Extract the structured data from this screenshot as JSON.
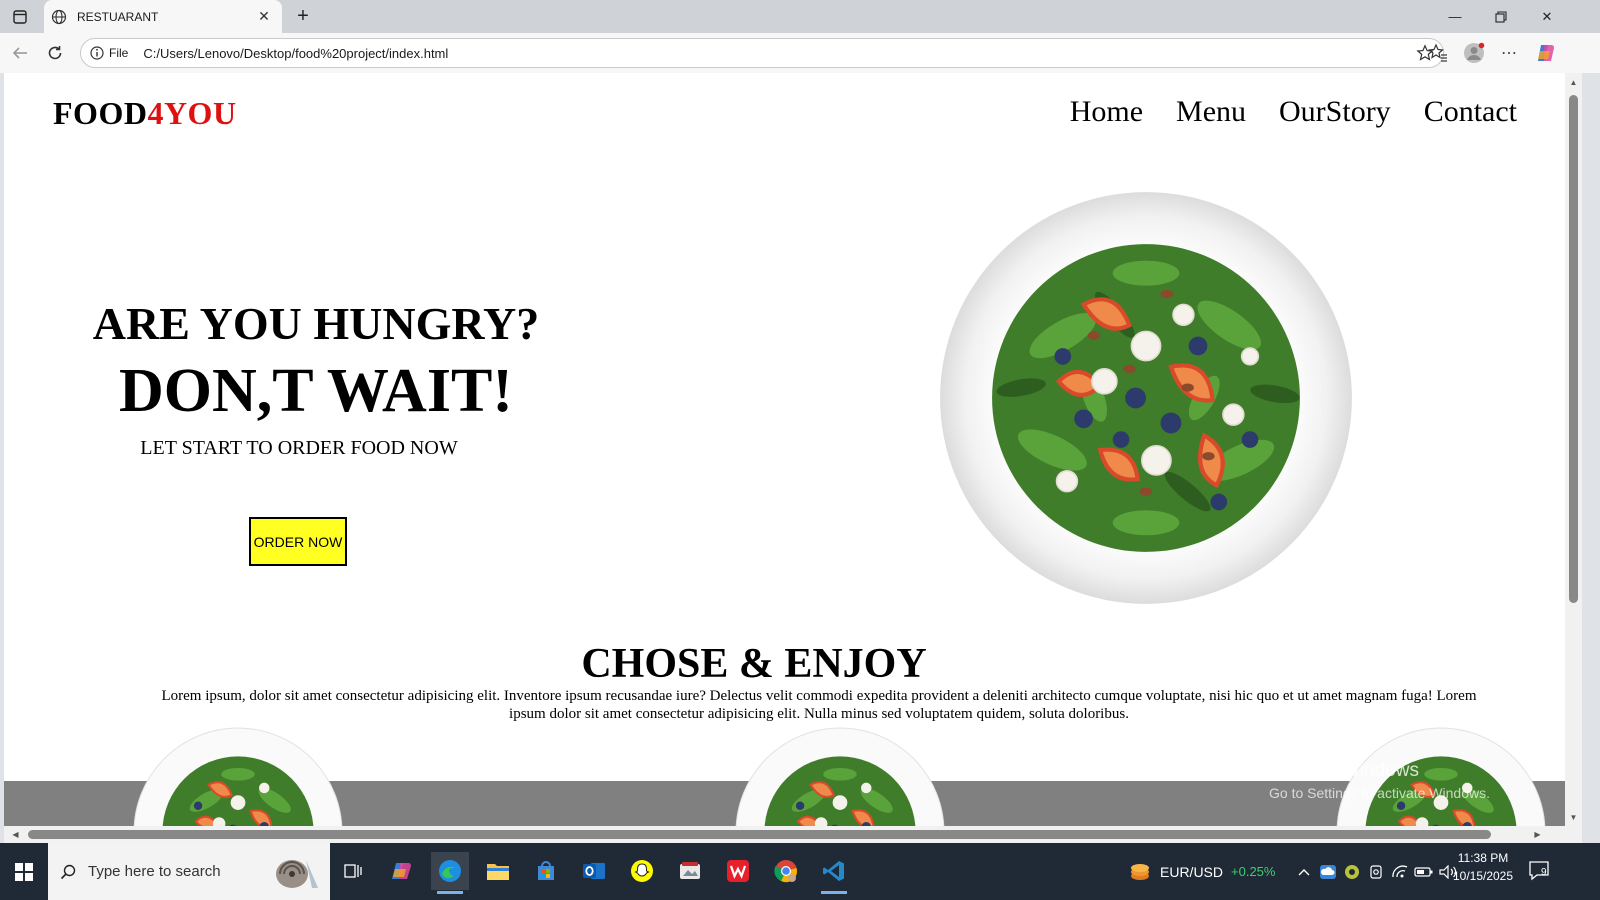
{
  "browser": {
    "tab_title": "RESTUARANT",
    "address_scheme": "File",
    "url": "C:/Users/Lenovo/Desktop/food%20project/index.html"
  },
  "site": {
    "logo_main": "FOOD",
    "logo_accent": "4YOU",
    "nav": [
      "Home",
      "Menu",
      "OurStory",
      "Contact"
    ],
    "hero": {
      "line1": "ARE YOU HUNGRY?",
      "line2": "DON,T WAIT!",
      "line3": "LET START TO ORDER FOOD NOW",
      "button": "ORDER NOW"
    },
    "section": {
      "title": "CHOSE & ENJOY",
      "text": "Lorem ipsum, dolor sit amet consectetur adipisicing elit. Inventore ipsum recusandae iure? Delectus velit commodi expedita provident a deleniti architecto cumque voluptate, nisi hic quo et ut amet magnam fuga! Lorem ipsum dolor sit amet consectetur adipisicing elit. Nulla minus sed voluptatem quidem, soluta doloribus."
    },
    "accent_color": "#e01010",
    "button_color": "#ffff22"
  },
  "watermark": {
    "line1": "Activate Windows",
    "line2": "Go to Settings to activate Windows."
  },
  "taskbar": {
    "search_placeholder": "Type here to search",
    "ticker_pair": "EUR/USD",
    "ticker_change": "+0.25%",
    "time": "11:38 PM",
    "date": "10/15/2025",
    "notification_count": "9"
  }
}
